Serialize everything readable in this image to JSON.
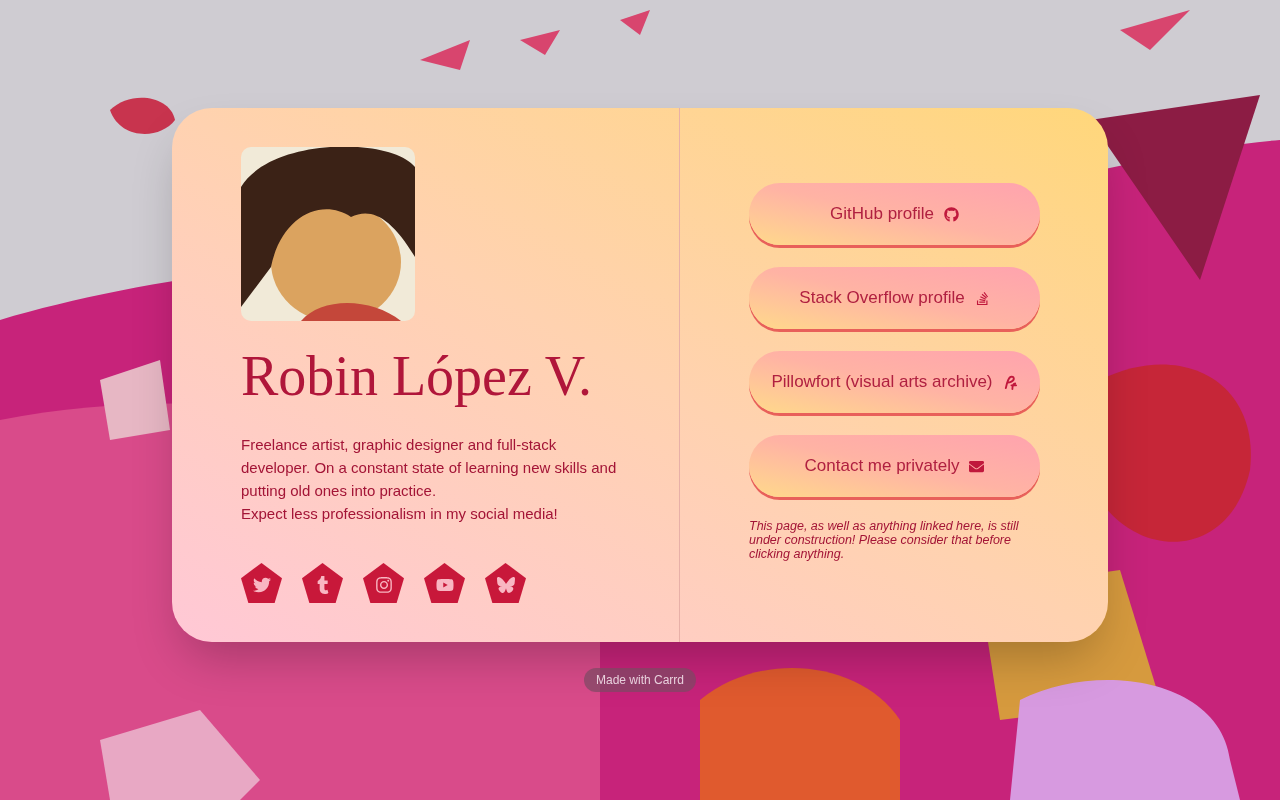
{
  "profile": {
    "name": "Robin López V.",
    "bio": [
      "Freelance artist, graphic designer and full-stack developer. On a constant state of learning new skills and putting old ones into practice.",
      "Expect less professionalism in my social media!"
    ]
  },
  "socials": [
    {
      "kind": "twitter"
    },
    {
      "kind": "tumblr"
    },
    {
      "kind": "instagram"
    },
    {
      "kind": "youtube"
    },
    {
      "kind": "butterfly"
    }
  ],
  "links": [
    {
      "label": "GitHub profile",
      "kind": "github"
    },
    {
      "label": "Stack Overflow profile",
      "kind": "stackoverflow"
    },
    {
      "label": "Pillowfort (visual arts archive)",
      "kind": "pillowfort"
    },
    {
      "label": "Contact me privately",
      "kind": "mail"
    }
  ],
  "notice": "This page, as well as anything linked here, is still under construction! Please consider that before clicking anything.",
  "footer_badge": "Made with Carrd"
}
